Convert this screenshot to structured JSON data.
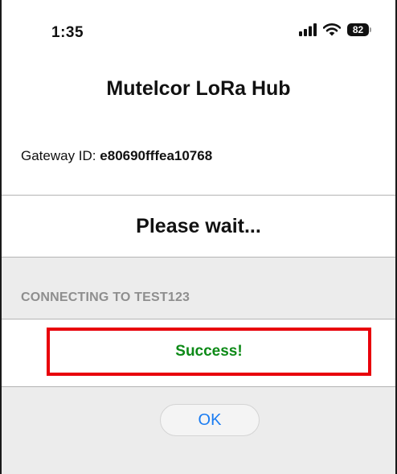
{
  "status_bar": {
    "time": "1:35",
    "battery": "82",
    "icons": [
      "cellular-signal-icon",
      "wifi-icon",
      "battery-icon"
    ]
  },
  "app": {
    "title": "Mutelcor LoRa Hub"
  },
  "gateway": {
    "label": "Gateway ID:",
    "value": "e80690fffea10768"
  },
  "wait": {
    "text": "Please wait..."
  },
  "connection": {
    "status_text": "CONNECTING TO TEST123",
    "result_text": "Success!"
  },
  "actions": {
    "ok_label": "OK"
  },
  "colors": {
    "success": "#0d8a17",
    "highlight_border": "#e8000b",
    "link_blue": "#1a7cf2",
    "muted_text": "#8e8e8e",
    "panel_grey": "#ececec"
  }
}
